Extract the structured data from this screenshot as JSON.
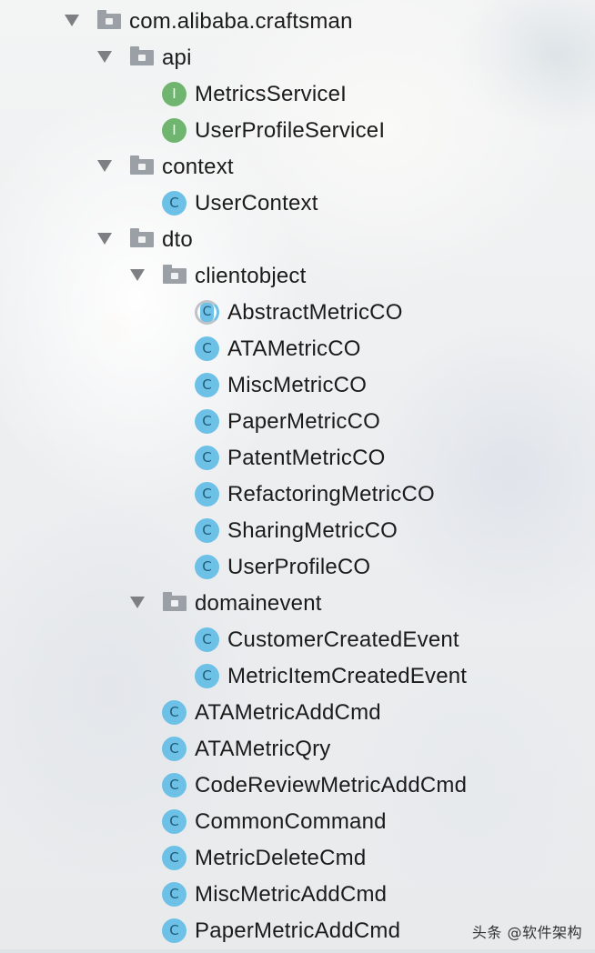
{
  "tree": {
    "items": [
      {
        "label": "com.alibaba.craftsman",
        "kind": "package",
        "expanded": true,
        "icon": "package-folder-icon"
      },
      {
        "label": "api",
        "kind": "package",
        "expanded": true,
        "icon": "package-folder-icon"
      },
      {
        "label": "MetricsServiceI",
        "kind": "interface",
        "icon_letter": "I",
        "icon": "interface-icon"
      },
      {
        "label": "UserProfileServiceI",
        "kind": "interface",
        "icon_letter": "I",
        "icon": "interface-icon"
      },
      {
        "label": "context",
        "kind": "package",
        "expanded": true,
        "icon": "package-folder-icon"
      },
      {
        "label": "UserContext",
        "kind": "class",
        "icon_letter": "C",
        "icon": "class-icon"
      },
      {
        "label": "dto",
        "kind": "package",
        "expanded": true,
        "icon": "package-folder-icon"
      },
      {
        "label": "clientobject",
        "kind": "package",
        "expanded": true,
        "icon": "package-folder-icon"
      },
      {
        "label": "AbstractMetricCO",
        "kind": "abstract-class",
        "icon_letter": "C",
        "icon": "abstract-class-icon"
      },
      {
        "label": "ATAMetricCO",
        "kind": "class",
        "icon_letter": "C",
        "icon": "class-icon"
      },
      {
        "label": "MiscMetricCO",
        "kind": "class",
        "icon_letter": "C",
        "icon": "class-icon"
      },
      {
        "label": "PaperMetricCO",
        "kind": "class",
        "icon_letter": "C",
        "icon": "class-icon"
      },
      {
        "label": "PatentMetricCO",
        "kind": "class",
        "icon_letter": "C",
        "icon": "class-icon"
      },
      {
        "label": "RefactoringMetricCO",
        "kind": "class",
        "icon_letter": "C",
        "icon": "class-icon"
      },
      {
        "label": "SharingMetricCO",
        "kind": "class",
        "icon_letter": "C",
        "icon": "class-icon"
      },
      {
        "label": "UserProfileCO",
        "kind": "class",
        "icon_letter": "C",
        "icon": "class-icon"
      },
      {
        "label": "domainevent",
        "kind": "package",
        "expanded": true,
        "icon": "package-folder-icon"
      },
      {
        "label": "CustomerCreatedEvent",
        "kind": "class",
        "icon_letter": "C",
        "icon": "class-icon"
      },
      {
        "label": "MetricItemCreatedEvent",
        "kind": "class",
        "icon_letter": "C",
        "icon": "class-icon"
      },
      {
        "label": "ATAMetricAddCmd",
        "kind": "class",
        "icon_letter": "C",
        "icon": "class-icon"
      },
      {
        "label": "ATAMetricQry",
        "kind": "class",
        "icon_letter": "C",
        "icon": "class-icon"
      },
      {
        "label": "CodeReviewMetricAddCmd",
        "kind": "class",
        "icon_letter": "C",
        "icon": "class-icon"
      },
      {
        "label": "CommonCommand",
        "kind": "class",
        "icon_letter": "C",
        "icon": "class-icon"
      },
      {
        "label": "MetricDeleteCmd",
        "kind": "class",
        "icon_letter": "C",
        "icon": "class-icon"
      },
      {
        "label": "MiscMetricAddCmd",
        "kind": "class",
        "icon_letter": "C",
        "icon": "class-icon"
      },
      {
        "label": "PaperMetricAddCmd",
        "kind": "class",
        "icon_letter": "C",
        "icon": "class-icon"
      }
    ]
  },
  "watermark": "头条 @软件架构",
  "colors": {
    "interface_badge": "#6fb56f",
    "class_badge": "#6ec1e6",
    "folder": "#9aa0a6",
    "arrow": "#7d7f82",
    "text": "#1b1b1b"
  }
}
